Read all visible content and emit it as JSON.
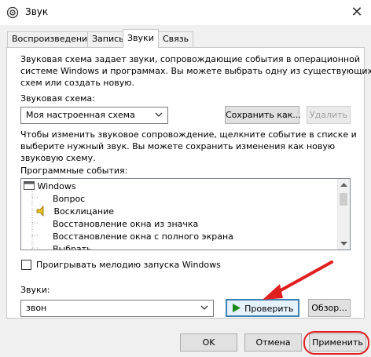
{
  "window": {
    "title": "Звук",
    "close_glyph": "✕"
  },
  "tabs": [
    {
      "label": "Воспроизведение",
      "active": false
    },
    {
      "label": "Запись",
      "active": false
    },
    {
      "label": "Звуки",
      "active": true
    },
    {
      "label": "Связь",
      "active": false
    }
  ],
  "description": [
    "Звуковая схема задает звуки, сопровождающие события в операционной",
    "системе Windows и программах. Вы можете выбрать одну из существующих",
    "схем или создать новую."
  ],
  "scheme": {
    "label": "Звуковая схема:",
    "value": "Моя настроенная схема",
    "save_button": "Сохранить как...",
    "delete_button": "Удалить"
  },
  "hint": [
    "Чтобы изменить звуковое сопровождение, щелкните событие в списке и",
    "выберите нужный звук. Вы можете сохранить изменения как новую",
    "звуковую схему."
  ],
  "events": {
    "label": "Программные события:",
    "items": [
      {
        "label": "Windows",
        "level": 0
      },
      {
        "label": "Вопрос",
        "level": 1
      },
      {
        "label": "Восклицание",
        "level": 1,
        "selected": true,
        "has_sound": true
      },
      {
        "label": "Восстановление окна из значка",
        "level": 1
      },
      {
        "label": "Восстановление окна с полного экрана",
        "level": 1
      },
      {
        "label": "Выбрать",
        "level": 1
      }
    ]
  },
  "startup_checkbox": {
    "label": "Проигрывать мелодию запуска Windows",
    "checked": false
  },
  "sounds": {
    "label": "Звуки:",
    "value": "звон",
    "test_button": "Проверить",
    "browse_button": "Обзор..."
  },
  "footer": {
    "ok": "OK",
    "cancel": "Отмена",
    "apply": "Применить"
  },
  "colors": {
    "annotation": "#e02020",
    "play_icon": "#1a8a1a"
  }
}
